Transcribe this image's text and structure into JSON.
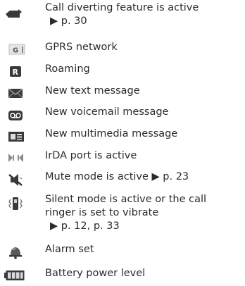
{
  "items": [
    {
      "icon": "call-divert-icon",
      "lines": [
        "Call diverting feature is active",
        "▶ p. 30"
      ]
    },
    {
      "icon": "gprs-icon",
      "lines": [
        "GPRS network"
      ]
    },
    {
      "icon": "roaming-icon",
      "lines": [
        "Roaming"
      ]
    },
    {
      "icon": "envelope-icon",
      "lines": [
        "New text message"
      ]
    },
    {
      "icon": "voicemail-icon",
      "lines": [
        "New voicemail message"
      ]
    },
    {
      "icon": "multimedia-message-icon",
      "lines": [
        "New multimedia message"
      ]
    },
    {
      "icon": "irda-icon",
      "lines": [
        "IrDA port is active"
      ]
    },
    {
      "icon": "mute-speaker-icon",
      "lines": [
        "Mute mode is active ▶ p. 23"
      ]
    },
    {
      "icon": "vibrate-icon",
      "lines": [
        "Silent mode is active or the call",
        "ringer is set to vibrate",
        "▶ p. 12, p. 33"
      ]
    },
    {
      "icon": "alarm-bell-icon",
      "lines": [
        "Alarm set"
      ]
    },
    {
      "icon": "battery-icon",
      "lines": [
        "Battery power level"
      ]
    }
  ],
  "colors": {
    "text": "#2b2b2b",
    "icon_dark": "#3a3a3a",
    "icon_mid": "#7a7a7a",
    "icon_light": "#cfcfcf"
  }
}
